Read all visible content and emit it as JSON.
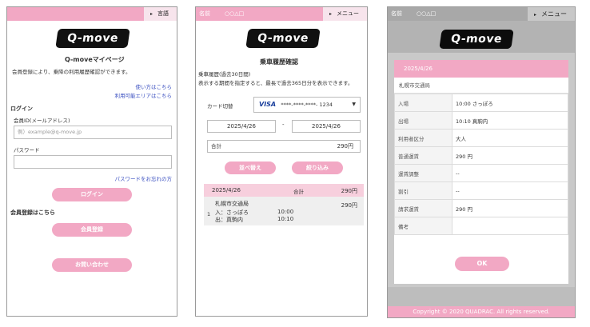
{
  "screen1": {
    "header_tab": "言語",
    "logo_text": "Q-move",
    "title": "Q-moveマイページ",
    "intro": "会員登録により、乗降の利用履歴確認ができます。",
    "link_howto": "使い方はこちら",
    "link_area": "利用可能エリアはこちら",
    "login_heading": "ログイン",
    "member_id_label": "会員ID(メールアドレス)",
    "member_id_placeholder": "例）example@q-move.jp",
    "password_label": "パスワード",
    "forgot_password": "パスワードをお忘れの方",
    "login_button": "ログイン",
    "register_heading": "会員登録はこちら",
    "register_button": "会員登録",
    "contact_button": "お問い合わせ"
  },
  "screen2": {
    "name_label": "名前",
    "name_value": "○○△□",
    "menu_label": "メニュー",
    "logo_text": "Q-move",
    "title": "乗車履歴確認",
    "desc1": "乗車履歴(過去30日間)",
    "desc2": "表示する期間を指定すると、最長で過去365日分を表示できます。",
    "card_label": "カード切替",
    "card_brand": "VISA",
    "card_number": "****-****-****- 1234",
    "date_from": "2025/4/26",
    "date_sep": "-",
    "date_to": "2025/4/26",
    "total_label": "合計",
    "total_value": "290円",
    "sort_button": "並べ替え",
    "filter_button": "絞り込み",
    "result": {
      "date": "2025/4/26",
      "sum_label": "合計",
      "sum_value": "290円",
      "operator": "札幌市交通局",
      "fare": "290円",
      "index": "1",
      "in_label": "入：さっぽろ",
      "in_time": "10:00",
      "out_label": "出：真駒内",
      "out_time": "10:10"
    }
  },
  "screen3": {
    "name_label": "名前",
    "name_value": "○○△□",
    "menu_label": "メニュー",
    "logo_text": "Q-move",
    "modal_date": "2025/4/26",
    "operator": "札幌市交通局",
    "rows": [
      {
        "key": "入場",
        "value": "10:00 さっぽろ"
      },
      {
        "key": "出場",
        "value": "10:10 真駒内"
      },
      {
        "key": "利用者区分",
        "value": "大人"
      },
      {
        "key": "普通運賃",
        "value": "290 円"
      },
      {
        "key": "運賃調整",
        "value": "--"
      },
      {
        "key": "割引",
        "value": "--"
      },
      {
        "key": "請求運賃",
        "value": "290 円"
      },
      {
        "key": "備考",
        "value": ""
      }
    ],
    "ok_button": "OK",
    "footer": "Copyright © 2020 QUADRAC. All rights reserved."
  },
  "colors": {
    "accent_pink": "#f2a8c4",
    "link_blue": "#3a4fc0",
    "visa_blue": "#1a3f9c"
  }
}
